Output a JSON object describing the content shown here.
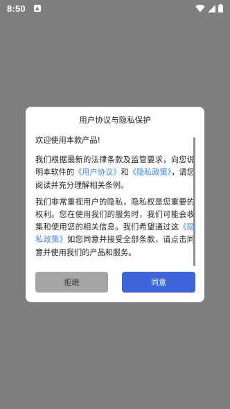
{
  "status_bar": {
    "time": "8:50",
    "icons": [
      "notification-a-icon",
      "wifi-icon",
      "signal-icon",
      "battery-icon"
    ]
  },
  "dialog": {
    "title": "用户协议与隐私保护",
    "greeting": "欢迎使用本款产品!",
    "para1": {
      "text1": "我们根据最新的法律条款及监管要求，向您说明本软件的",
      "link1": "《用户协议》",
      "text2": "和",
      "link2": "《隐私政策》",
      "text3": "，请您阅读并充分理解相关条例。"
    },
    "para2": {
      "text1": "我们非常重视用户的隐私，隐私权是您重要的权利。您在使用我们的服务时，我们可能会收集和使用您的相关信息。我们希望通过这",
      "link1": "《隐私政策》",
      "text2": "如您同意并接受全部条款，请点击同意并使用我们的产品和服务。"
    },
    "reject_label": "拒绝",
    "agree_label": "同意"
  },
  "colors": {
    "overlay": "#7f7f7f",
    "link": "#3b84f5",
    "agree_button": "#3f63d8",
    "reject_button": "#a5a5a5"
  }
}
